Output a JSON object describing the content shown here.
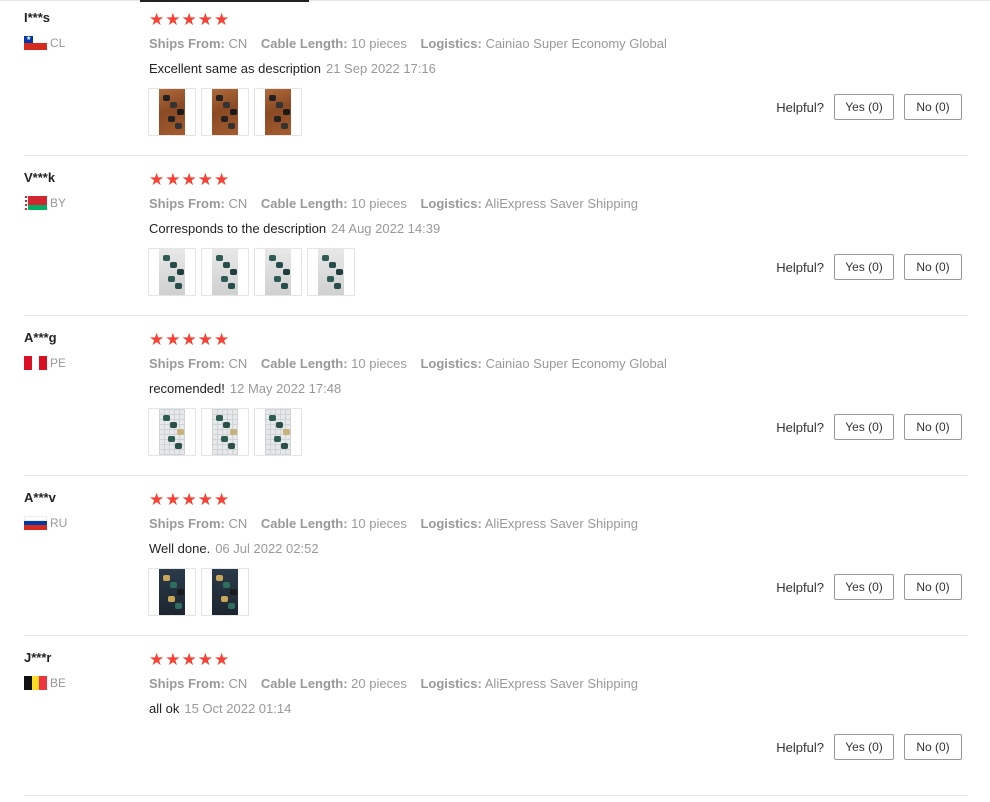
{
  "labels": {
    "ships_from": "Ships From:",
    "cable_length": "Cable Length:",
    "logistics": "Logistics:",
    "helpful": "Helpful?"
  },
  "colors": {
    "star": "#f44336",
    "muted": "#999999"
  },
  "reviews": [
    {
      "user": "I***s",
      "country": "CL",
      "flag": "chile",
      "rating": 5,
      "ships_from": "CN",
      "cable_length": "10 pieces",
      "logistics": "Cainiao Super Economy Global",
      "text": "Excellent same as description",
      "date": "21 Sep 2022 17:16",
      "photos": [
        "wood",
        "wood",
        "wood"
      ],
      "yes": "Yes (0)",
      "no": "No (0)"
    },
    {
      "user": "V***k",
      "country": "BY",
      "flag": "belarus",
      "rating": 5,
      "ships_from": "CN",
      "cable_length": "10 pieces",
      "logistics": "AliExpress Saver Shipping",
      "text": "Corresponds to the description",
      "date": "24 Aug 2022 14:39",
      "photos": [
        "light",
        "light",
        "light",
        "light"
      ],
      "yes": "Yes (0)",
      "no": "No (0)"
    },
    {
      "user": "A***g",
      "country": "PE",
      "flag": "peru",
      "rating": 5,
      "ships_from": "CN",
      "cable_length": "10 pieces",
      "logistics": "Cainiao Super Economy Global",
      "text": "recomended!",
      "date": "12 May 2022 17:48",
      "photos": [
        "grid",
        "grid",
        "grid"
      ],
      "yes": "Yes (0)",
      "no": "No (0)"
    },
    {
      "user": "A***v",
      "country": "RU",
      "flag": "russia",
      "rating": 5,
      "ships_from": "CN",
      "cable_length": "10 pieces",
      "logistics": "AliExpress Saver Shipping",
      "text": "Well done.",
      "date": "06 Jul 2022 02:52",
      "photos": [
        "dark",
        "dark"
      ],
      "yes": "Yes (0)",
      "no": "No (0)"
    },
    {
      "user": "J***r",
      "country": "BE",
      "flag": "belgium",
      "rating": 5,
      "ships_from": "CN",
      "cable_length": "20 pieces",
      "logistics": "AliExpress Saver Shipping",
      "text": "all ok",
      "date": "15 Oct 2022 01:14",
      "photos": [],
      "yes": "Yes (0)",
      "no": "No (0)"
    }
  ]
}
